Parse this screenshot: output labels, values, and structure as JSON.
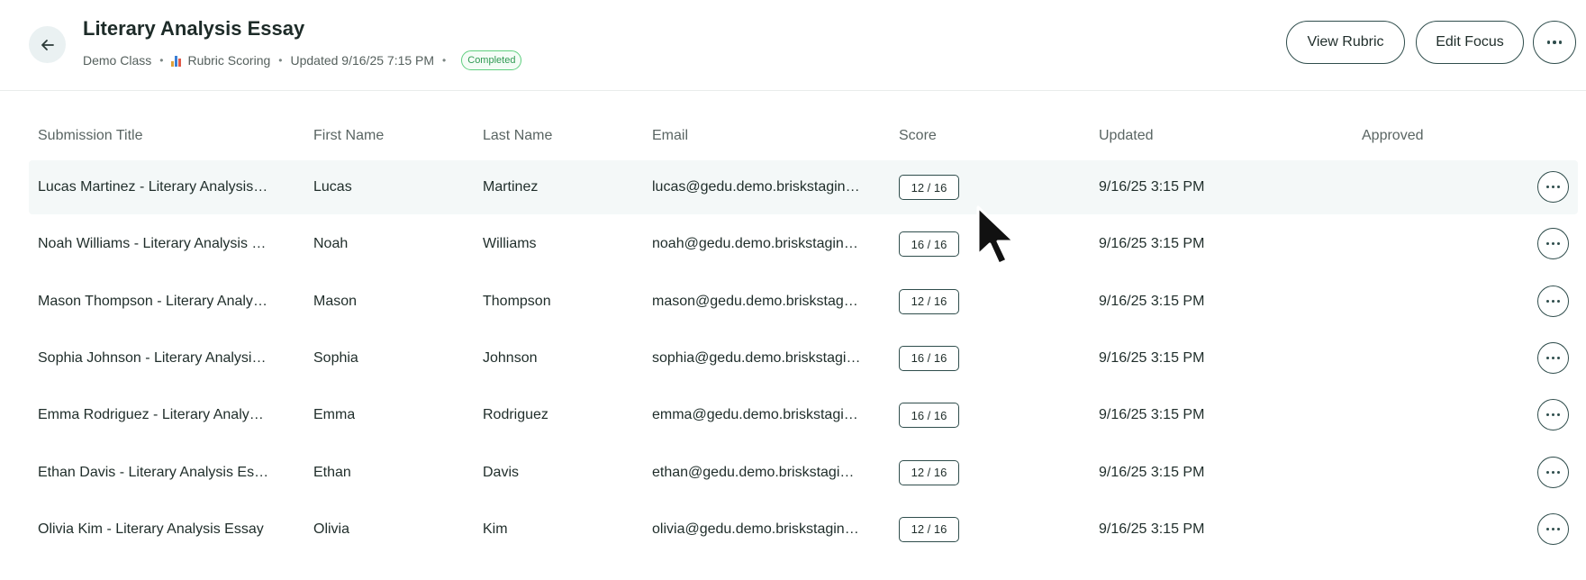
{
  "header": {
    "title": "Literary Analysis Essay",
    "class_name": "Demo Class",
    "scoring_type": "Rubric Scoring",
    "scoring_icon": "bar-chart-icon",
    "updated": "Updated 9/16/25 7:15 PM",
    "status": "Completed",
    "view_rubric_label": "View Rubric",
    "edit_focus_label": "Edit Focus",
    "colors": {
      "status_green": "#2f9a52",
      "accent": "#2f4d4c"
    }
  },
  "table": {
    "columns": [
      "Submission Title",
      "First Name",
      "Last Name",
      "Email",
      "Score",
      "Updated",
      "Approved"
    ],
    "rows": [
      {
        "title": "Lucas Martinez - Literary Analysis Essay",
        "first": "Lucas",
        "last": "Martinez",
        "email": "lucas@gedu.demo.briskstaging.com",
        "score": "12 / 16",
        "updated": "9/16/25 3:15 PM",
        "approved": ""
      },
      {
        "title": "Noah Williams - Literary Analysis Essay",
        "first": "Noah",
        "last": "Williams",
        "email": "noah@gedu.demo.briskstaging.com",
        "score": "16 / 16",
        "updated": "9/16/25 3:15 PM",
        "approved": ""
      },
      {
        "title": "Mason Thompson - Literary Analysis Essay",
        "first": "Mason",
        "last": "Thompson",
        "email": "mason@gedu.demo.briskstaging.com",
        "score": "12 / 16",
        "updated": "9/16/25 3:15 PM",
        "approved": ""
      },
      {
        "title": "Sophia Johnson - Literary Analysis Essay",
        "first": "Sophia",
        "last": "Johnson",
        "email": "sophia@gedu.demo.briskstaging.com",
        "score": "16 / 16",
        "updated": "9/16/25 3:15 PM",
        "approved": ""
      },
      {
        "title": "Emma Rodriguez - Literary Analysis Essay",
        "first": "Emma",
        "last": "Rodriguez",
        "email": "emma@gedu.demo.briskstaging.com",
        "score": "16 / 16",
        "updated": "9/16/25 3:15 PM",
        "approved": ""
      },
      {
        "title": "Ethan Davis - Literary Analysis Essay",
        "first": "Ethan",
        "last": "Davis",
        "email": "ethan@gedu.demo.briskstaging.com",
        "score": "12 / 16",
        "updated": "9/16/25 3:15 PM",
        "approved": ""
      },
      {
        "title": "Olivia Kim - Literary Analysis Essay",
        "first": "Olivia",
        "last": "Kim",
        "email": "olivia@gedu.demo.briskstaging.com",
        "score": "12 / 16",
        "updated": "9/16/25 3:15 PM",
        "approved": ""
      }
    ]
  }
}
